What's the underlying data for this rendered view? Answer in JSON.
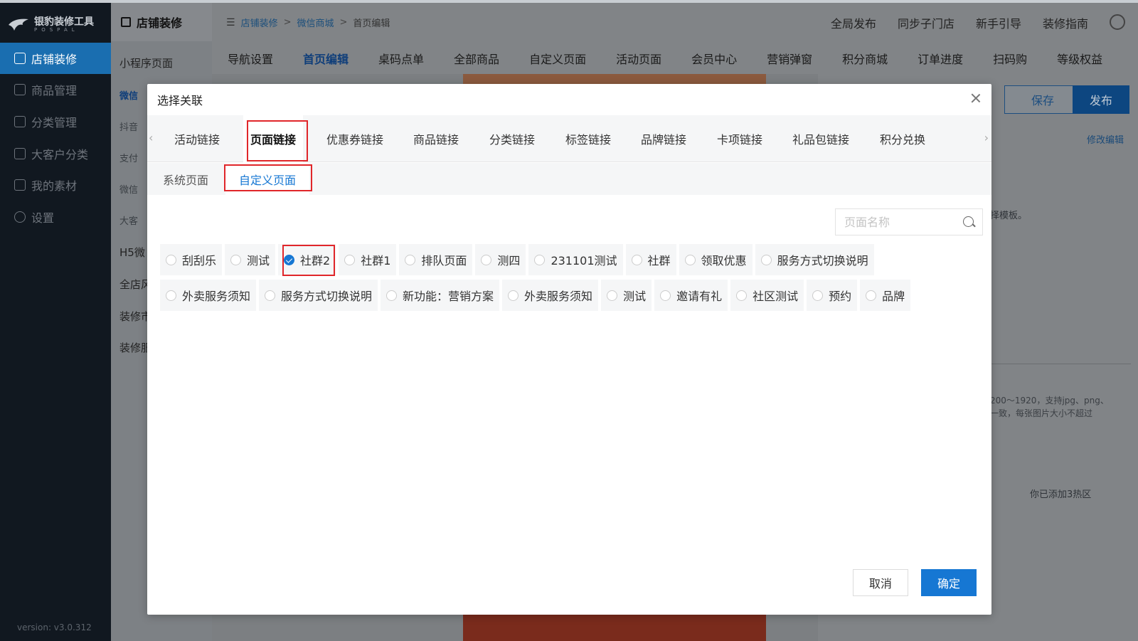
{
  "app": {
    "logo_title": "银豹装修工具",
    "logo_sub": "POSPAL",
    "version": "version: v3.0.312"
  },
  "nav": {
    "items": [
      {
        "label": "店铺装修"
      },
      {
        "label": "商品管理"
      },
      {
        "label": "分类管理"
      },
      {
        "label": "大客户分类"
      },
      {
        "label": "我的素材"
      },
      {
        "label": "设置"
      }
    ]
  },
  "sub_nav": {
    "header": "店铺装修",
    "section": "小程序页面",
    "small_items": [
      "微信",
      "抖音",
      "支付",
      "微信",
      "大客"
    ],
    "groups": [
      "H5微",
      "全店风",
      "装修市",
      "装修服"
    ]
  },
  "breadcrumb": [
    "店铺装修",
    "微信商城",
    "首页编辑"
  ],
  "top_links": [
    "全局发布",
    "同步子门店",
    "新手引导",
    "装修指南"
  ],
  "main_tabs": [
    "导航设置",
    "首页编辑",
    "桌码点单",
    "全部商品",
    "自定义页面",
    "活动页面",
    "会员中心",
    "营销弹窗",
    "积分商城",
    "订单进度",
    "扫码购",
    "等级权益"
  ],
  "actions": {
    "save": "保存",
    "publish": "发布",
    "edit": "修改编辑"
  },
  "bg_text": {
    "hint1": "择模板。",
    "hint2_line1": "200～1920，支持jpg、png、",
    "hint2_line2": "一致，每张图片大小不超过",
    "hot": "你已添加3热区"
  },
  "modal": {
    "title": "选择关联",
    "tabs": [
      "活动链接",
      "页面链接",
      "优惠券链接",
      "商品链接",
      "分类链接",
      "标签链接",
      "品牌链接",
      "卡项链接",
      "礼品包链接",
      "积分兑换"
    ],
    "subtabs": [
      "系统页面",
      "自定义页面"
    ],
    "search_placeholder": "页面名称",
    "row1": [
      "刮刮乐",
      "测试",
      "社群2",
      "社群1",
      "排队页面",
      "测四",
      "231101测试",
      "社群",
      "领取优惠",
      "服务方式切换说明"
    ],
    "row2": [
      "外卖服务须知",
      "服务方式切换说明",
      "新功能：营销方案",
      "外卖服务须知",
      "测试",
      "邀请有礼",
      "社区测试",
      "预约",
      "品牌"
    ],
    "cancel": "取消",
    "confirm": "确定"
  },
  "colors": {
    "primary": "#1677d3",
    "highlight": "#e0262a",
    "nav_active": "#1a6eb0"
  }
}
